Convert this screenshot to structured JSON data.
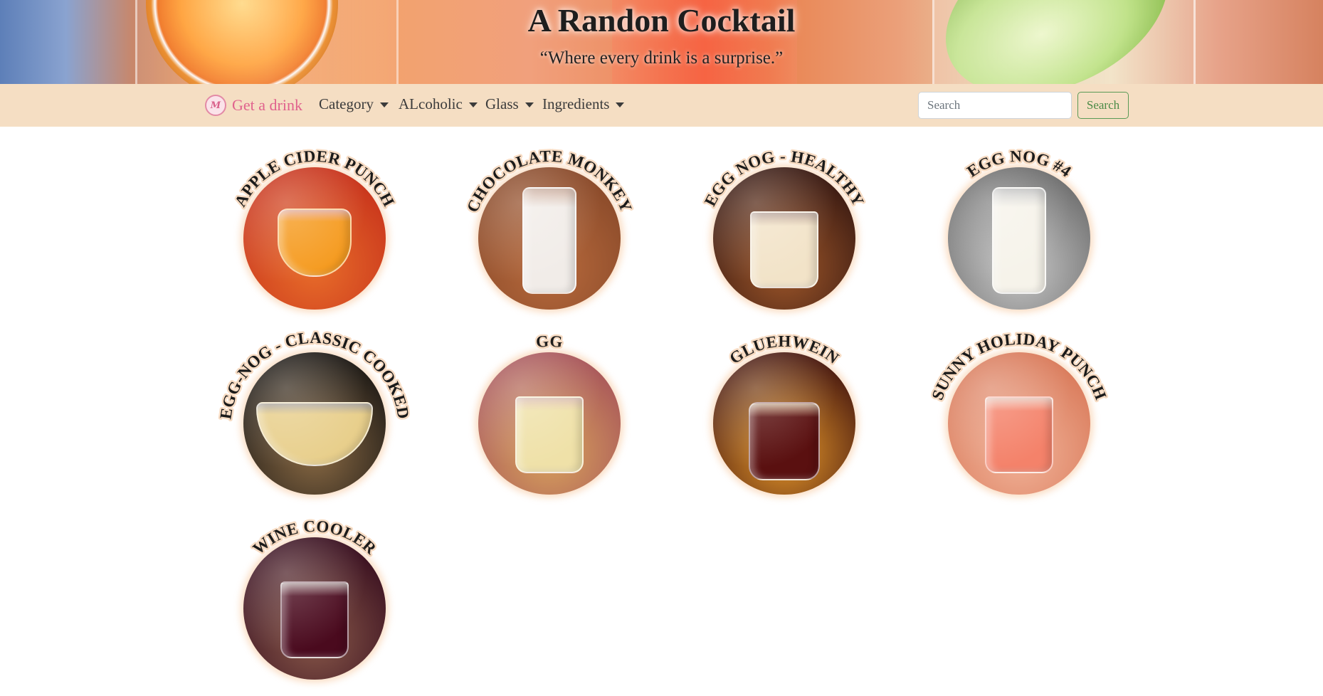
{
  "hero": {
    "title": "A Randon Cocktail",
    "subtitle": "“Where every drink is a surprise.”"
  },
  "navbar": {
    "brand_label": "Get a drink",
    "brand_logo_text": "M",
    "menus": [
      {
        "label": "Category"
      },
      {
        "label": "ALcoholic"
      },
      {
        "label": "Glass"
      },
      {
        "label": "Ingredients"
      }
    ],
    "search_placeholder": "Search",
    "search_button": "Search"
  },
  "drinks": [
    {
      "name": "APPLE CIDER PUNCH",
      "photo": {
        "bg": [
          "#c8341c",
          "#e86d2a"
        ],
        "liquid": "#f59a1e",
        "glass": "tumbler-cup"
      }
    },
    {
      "name": "CHOCOLATE MONKEY",
      "photo": {
        "bg": [
          "#8a4a2a",
          "#b86a3c"
        ],
        "liquid": "#f1ece8",
        "glass": "tall"
      }
    },
    {
      "name": "EGG NOG - HEALTHY",
      "photo": {
        "bg": [
          "#3a1a12",
          "#a0582a"
        ],
        "liquid": "#f2e3c8",
        "glass": "rocks"
      }
    },
    {
      "name": "EGG NOG #4",
      "photo": {
        "bg": [
          "#6e6e6e",
          "#c9c9c9"
        ],
        "liquid": "#f6f3ea",
        "glass": "tall"
      }
    },
    {
      "name": "EGG-NOG - CLASSIC COOKED",
      "photo": {
        "bg": [
          "#1e1a16",
          "#8a6a44"
        ],
        "liquid": "#e8cf8c",
        "glass": "bowl"
      }
    },
    {
      "name": "GG",
      "photo": {
        "bg": [
          "#a8565a",
          "#d9a45c"
        ],
        "liquid": "#efe1a8",
        "glass": "rocks"
      }
    },
    {
      "name": "GLUEHWEIN",
      "photo": {
        "bg": [
          "#4a1a10",
          "#e89a2a"
        ],
        "liquid": "#5a1010",
        "glass": "mug"
      }
    },
    {
      "name": "SUNNY HOLIDAY PUNCH",
      "photo": {
        "bg": [
          "#d97a5a",
          "#f2b49a"
        ],
        "liquid": "#f4826a",
        "glass": "rocks"
      }
    },
    {
      "name": "WINE COOLER",
      "photo": {
        "bg": [
          "#3a1020",
          "#8a5a4a"
        ],
        "liquid": "#4a0a1e",
        "glass": "rocks"
      }
    }
  ]
}
